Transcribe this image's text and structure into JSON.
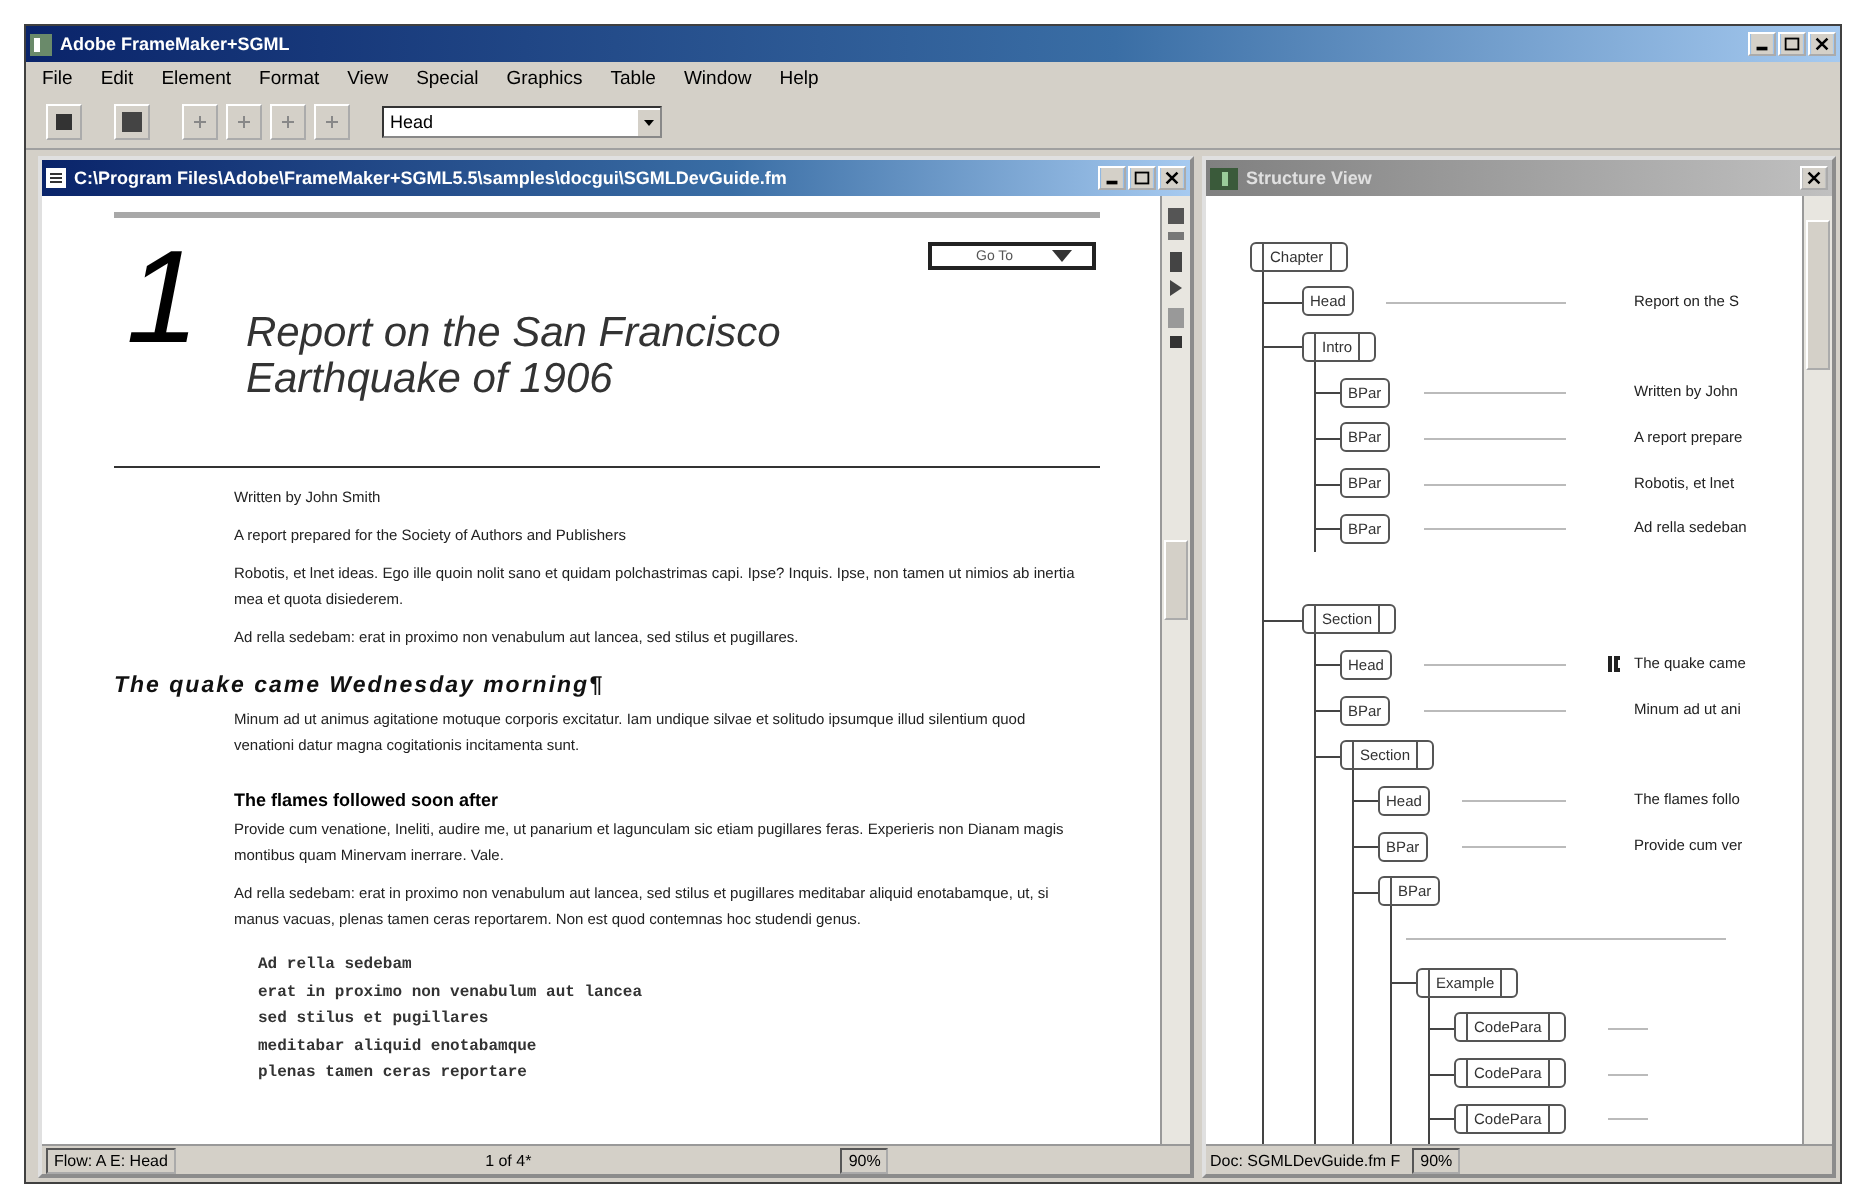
{
  "app_window": {
    "title": "Adobe FrameMaker+SGML"
  },
  "menu_bar": [
    "File",
    "Edit",
    "Element",
    "Format",
    "View",
    "Special",
    "Graphics",
    "Table",
    "Window",
    "Help"
  ],
  "toolbar": {
    "paragraph_tag": "Head"
  },
  "document_window": {
    "title": "C:\\Program Files\\Adobe\\FrameMaker+SGML5.5\\samples\\docgui\\SGMLDevGuide.fm",
    "go_to_button": "Go To",
    "chapter_number": "1",
    "chapter_title": "Report on the San Francisco Earthquake of 1906",
    "blocks": [
      {
        "kind": "para",
        "text": "Written by John Smith"
      },
      {
        "kind": "para",
        "text": "A report prepared for the Society of Authors and Publishers"
      },
      {
        "kind": "para",
        "text": "Robotis, et lnet ideas. Ego ille quoin nolit sano et quidam polchastrimas capi. Ipse? Inquis. Ipse, non tamen ut nimios ab inertia mea et quota disiederem."
      },
      {
        "kind": "para",
        "text": "Ad rella sedebam: erat in proximo non venabulum aut lancea, sed stilus et pugillares."
      },
      {
        "kind": "heading",
        "text": "The quake came Wednesday morning¶"
      },
      {
        "kind": "para",
        "text": "Minum ad ut animus agitatione motuque corporis excitatur. Iam undique silvae et solitudo ipsumque illud silentium quod venationi datur magna cogitationis incitamenta sunt."
      },
      {
        "kind": "subheading",
        "text": "The flames followed soon after"
      },
      {
        "kind": "para",
        "text": "Provide cum venatione, Ineliti, audire me, ut panarium et lagunculam sic etiam pugillares feras. Experieris non Dianam magis montibus quam Minervam inerrare. Vale."
      },
      {
        "kind": "para",
        "text": "Ad rella sedebam: erat in proximo non venabulum aut lancea, sed stilus et pugillares meditabar aliquid enotabamque, ut, si manus vacuas, plenas tamen ceras reportarem. Non est quod contemnas hoc studendi genus."
      },
      {
        "kind": "code",
        "lines": [
          "Ad rella sedebam",
          "erat in proximo non venabulum aut lancea",
          "sed stilus et pugillares",
          "meditabar aliquid enotabamque",
          "plenas tamen ceras reportare"
        ]
      }
    ],
    "status_bar": {
      "flow": "Flow: A  E: Head",
      "page": "1 of 4*",
      "zoom": "90%"
    }
  },
  "structure_window": {
    "title": "Structure View",
    "tree": [
      {
        "label": "Chapter",
        "kind": "container",
        "current": false,
        "children": [
          {
            "label": "Head",
            "kind": "element",
            "current": false,
            "snippet": "Report on the S"
          },
          {
            "label": "Intro",
            "kind": "container",
            "current": false,
            "children": [
              {
                "label": "BPar",
                "kind": "element",
                "current": false,
                "snippet": "Written by John"
              },
              {
                "label": "BPar",
                "kind": "element",
                "current": false,
                "snippet": "A report prepare"
              },
              {
                "label": "BPar",
                "kind": "element",
                "current": false,
                "snippet": "Robotis, et lnet"
              },
              {
                "label": "BPar",
                "kind": "element",
                "current": false,
                "snippet": "Ad rella sedeban"
              }
            ]
          },
          {
            "label": "Section",
            "kind": "container",
            "current": false,
            "children": [
              {
                "label": "Head",
                "kind": "element",
                "current": true,
                "snippet": "The quake came"
              },
              {
                "label": "BPar",
                "kind": "element",
                "current": false,
                "snippet": "Minum ad ut ani"
              },
              {
                "label": "Section",
                "kind": "container",
                "current": false,
                "children": [
                  {
                    "label": "Head",
                    "kind": "element",
                    "current": false,
                    "snippet": "The flames follo"
                  },
                  {
                    "label": "BPar",
                    "kind": "element",
                    "current": false,
                    "snippet": "Provide cum ver"
                  },
                  {
                    "label": "BPar",
                    "kind": "text-container",
                    "current": false,
                    "children": [
                      {
                        "label": "Example",
                        "kind": "container",
                        "current": false,
                        "children": [
                          {
                            "label": "CodePara",
                            "kind": "collapsed",
                            "current": false
                          },
                          {
                            "label": "CodePara",
                            "kind": "collapsed",
                            "current": false
                          },
                          {
                            "label": "CodePara",
                            "kind": "collapsed",
                            "current": false
                          }
                        ]
                      }
                    ]
                  }
                ]
              }
            ]
          }
        ]
      }
    ],
    "status_bar": {
      "doc": "Doc: SGMLDevGuide.fm F",
      "zoom": "90%"
    }
  }
}
